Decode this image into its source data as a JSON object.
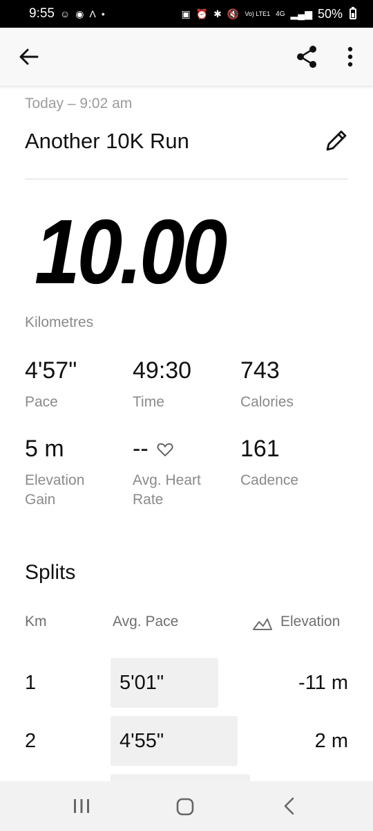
{
  "status_bar": {
    "time": "9:55",
    "left_icons": [
      "notification-icon",
      "record-icon",
      "app-icon",
      "dot-icon"
    ],
    "network_label": "Vo) LTE1",
    "data_label": "4G",
    "battery_percent": "50%",
    "battery_level": 0.5
  },
  "app_bar": {
    "icons": [
      "back-arrow-icon",
      "share-icon",
      "more-vertical-icon"
    ]
  },
  "activity": {
    "date": "Today – 9:02 am",
    "title": "Another 10K Run"
  },
  "distance": {
    "value": "10.00",
    "unit": "Kilometres"
  },
  "stats": [
    {
      "value": "4'57\"",
      "label": "Pace"
    },
    {
      "value": "49:30",
      "label": "Time"
    },
    {
      "value": "743",
      "label": "Calories"
    },
    {
      "value": "5 m",
      "label_line1": "Elevation",
      "label_line2": "Gain"
    },
    {
      "value": "--",
      "label_line1": "Avg. Heart",
      "label_line2": "Rate"
    },
    {
      "value": "161",
      "label": "Cadence"
    }
  ],
  "splits": {
    "title": "Splits",
    "headers": {
      "km": "Km",
      "pace": "Avg. Pace",
      "elevation": "Elevation"
    },
    "rows": [
      {
        "km": "1",
        "pace": "5'01\"",
        "elevation": "-11 m",
        "pace_fraction": 0.68
      },
      {
        "km": "2",
        "pace": "4'55\"",
        "elevation": "2 m",
        "pace_fraction": 0.8
      },
      {
        "km": "",
        "pace": "",
        "elevation": "",
        "pace_fraction": 0.88
      }
    ]
  },
  "colors": {
    "accent": "#000000",
    "secondary_text": "#8a8a8a",
    "bar_fill": "#f0f0f0"
  }
}
